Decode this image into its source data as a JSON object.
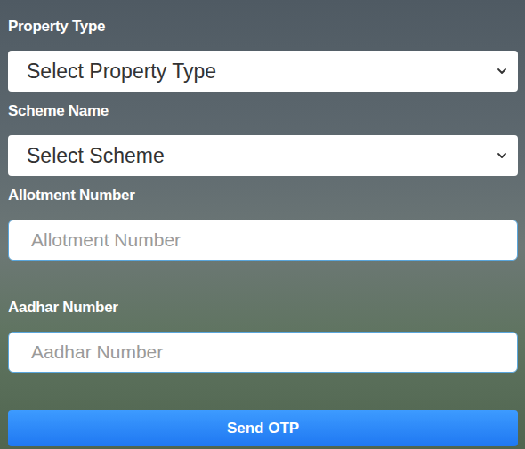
{
  "form": {
    "fields": [
      {
        "kind": "select",
        "label": "Property Type",
        "value": "Select Property Type"
      },
      {
        "kind": "select",
        "label": "Scheme Name",
        "value": "Select Scheme"
      },
      {
        "kind": "input",
        "label": "Allotment Number",
        "placeholder": "Allotment Number"
      },
      {
        "kind": "input",
        "label": "Aadhar Number",
        "placeholder": "Aadhar Number"
      }
    ],
    "submit": {
      "label": "Send OTP"
    }
  }
}
